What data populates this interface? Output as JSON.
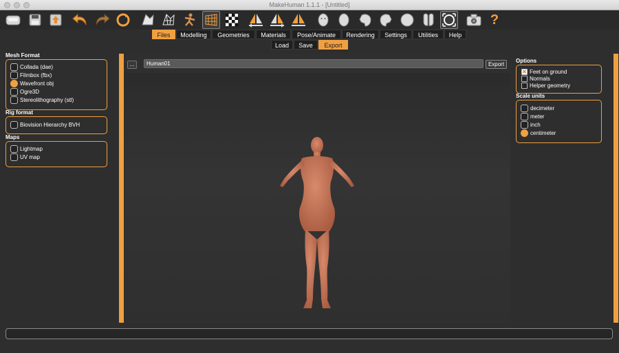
{
  "window": {
    "title": "MakeHuman 1.1.1 - [Untitled]"
  },
  "toolbar": {
    "buttons": [
      {
        "name": "wireframe-icon"
      },
      {
        "name": "save-icon"
      },
      {
        "name": "export-icon"
      },
      {
        "name": "undo-icon"
      },
      {
        "name": "redo-icon"
      },
      {
        "name": "reset-icon"
      },
      {
        "name": "smooth-icon"
      },
      {
        "name": "wireframe-mesh-icon"
      },
      {
        "name": "pose-icon"
      },
      {
        "name": "grid-icon"
      },
      {
        "name": "checker-icon"
      },
      {
        "name": "symmetry-left-icon"
      },
      {
        "name": "symmetry-right-icon"
      },
      {
        "name": "symmetry-icon"
      },
      {
        "name": "front-view-icon"
      },
      {
        "name": "back-view-icon"
      },
      {
        "name": "left-view-icon"
      },
      {
        "name": "right-view-icon"
      },
      {
        "name": "top-view-icon"
      },
      {
        "name": "bottom-view-icon"
      },
      {
        "name": "reset-camera-icon"
      },
      {
        "name": "screenshot-icon"
      },
      {
        "name": "help-icon"
      }
    ],
    "help_glyph": "?"
  },
  "tabs": {
    "items": [
      "Files",
      "Modelling",
      "Geometries",
      "Materials",
      "Pose/Animate",
      "Rendering",
      "Settings",
      "Utilities",
      "Help"
    ],
    "active": "Files"
  },
  "subtabs": {
    "items": [
      "Load",
      "Save",
      "Export"
    ],
    "active": "Export"
  },
  "left": {
    "mesh_format": {
      "title": "Mesh Format",
      "options": [
        "Collada (dae)",
        "Filmbox (fbx)",
        "Wavefront obj",
        "Ogre3D",
        "Stereolithography (stl)"
      ],
      "selected": "Wavefront obj"
    },
    "rig_format": {
      "title": "Rig format",
      "options": [
        "Biovision Hierarchy BVH"
      ]
    },
    "maps": {
      "title": "Maps",
      "options": [
        "Lightmap",
        "UV map"
      ]
    }
  },
  "export_bar": {
    "browse_label": "...",
    "filename": "Human01",
    "export_label": "Export"
  },
  "right": {
    "options": {
      "title": "Options",
      "items": [
        "Feet on ground",
        "Normals",
        "Helper geometry"
      ],
      "checked": [
        "Feet on ground"
      ]
    },
    "scale_units": {
      "title": "Scale units",
      "items": [
        "decimeter",
        "meter",
        "inch",
        "centimeter"
      ],
      "selected": "centimeter"
    }
  },
  "colors": {
    "accent": "#f0a040",
    "background": "#2e2e2e",
    "skin": "#c8745a"
  },
  "status": {
    "text": ""
  }
}
